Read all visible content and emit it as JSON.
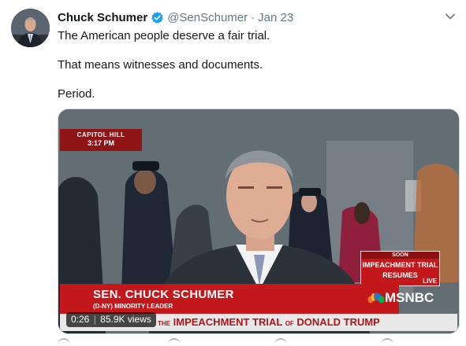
{
  "tweet": {
    "author_name": "Chuck Schumer",
    "handle": "@SenSchumer",
    "separator": "·",
    "date": "Jan 23",
    "paragraphs": [
      "The American people deserve a fair trial.",
      "That means witnesses and documents.",
      "Period."
    ],
    "verified_icon": "verified-badge-icon",
    "menu_icon": "chevron-down-icon"
  },
  "video": {
    "location": "CAPITOL HILL",
    "time": "3:17 PM",
    "soon_label": "SOON",
    "promo_line1": "IMPEACHMENT TRIAL",
    "promo_line2": "RESUMES",
    "live_label": "LIVE",
    "guest_name": "SEN. CHUCK SCHUMER",
    "guest_title": "(D-NY) MINORITY LEADER",
    "network": "MSNBC",
    "ticker_prefix": "THE",
    "ticker_part1": "IMPEACHMENT TRIAL",
    "ticker_of": "OF",
    "ticker_part2": "DONALD TRUMP",
    "duration": "0:26",
    "views": "85.9K views"
  },
  "colors": {
    "brand_blue": "#1da1f2",
    "text_primary": "#14171a",
    "text_secondary": "#657786",
    "msnbc_red": "#c2181c"
  }
}
